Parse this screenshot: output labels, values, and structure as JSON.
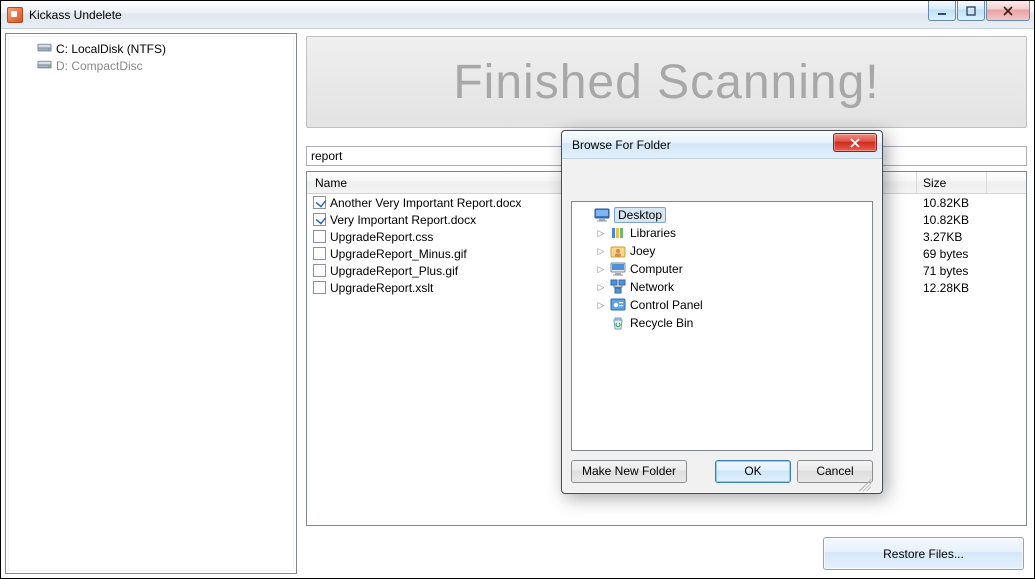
{
  "window": {
    "title": "Kickass Undelete",
    "minimize_label": "Minimize",
    "maximize_label": "Maximize",
    "close_label": "Close"
  },
  "drives": [
    {
      "label": "C: LocalDisk (NTFS)",
      "dimmed": false
    },
    {
      "label": "D: CompactDisc",
      "dimmed": true
    }
  ],
  "banner": "Finished Scanning!",
  "filter_value": "report",
  "columns": {
    "name": "Name",
    "size": "Size"
  },
  "files": [
    {
      "checked": true,
      "name": "Another Very Important Report.docx",
      "size": "10.82KB"
    },
    {
      "checked": true,
      "name": "Very Important Report.docx",
      "size": "10.82KB"
    },
    {
      "checked": false,
      "name": "UpgradeReport.css",
      "size": "3.27KB"
    },
    {
      "checked": false,
      "name": "UpgradeReport_Minus.gif",
      "size": "69 bytes"
    },
    {
      "checked": false,
      "name": "UpgradeReport_Plus.gif",
      "size": "71 bytes"
    },
    {
      "checked": false,
      "name": "UpgradeReport.xslt",
      "size": "12.28KB"
    }
  ],
  "restore_button": "Restore Files...",
  "dialog": {
    "title": "Browse For Folder",
    "items": [
      {
        "label": "Desktop",
        "icon": "desktop",
        "selected": true,
        "expandable": false
      },
      {
        "label": "Libraries",
        "icon": "libraries",
        "selected": false,
        "expandable": true
      },
      {
        "label": "Joey",
        "icon": "user",
        "selected": false,
        "expandable": true
      },
      {
        "label": "Computer",
        "icon": "computer",
        "selected": false,
        "expandable": true
      },
      {
        "label": "Network",
        "icon": "network",
        "selected": false,
        "expandable": true
      },
      {
        "label": "Control Panel",
        "icon": "control",
        "selected": false,
        "expandable": true
      },
      {
        "label": "Recycle Bin",
        "icon": "recycle",
        "selected": false,
        "expandable": false
      }
    ],
    "make_new_folder": "Make New Folder",
    "ok": "OK",
    "cancel": "Cancel"
  }
}
